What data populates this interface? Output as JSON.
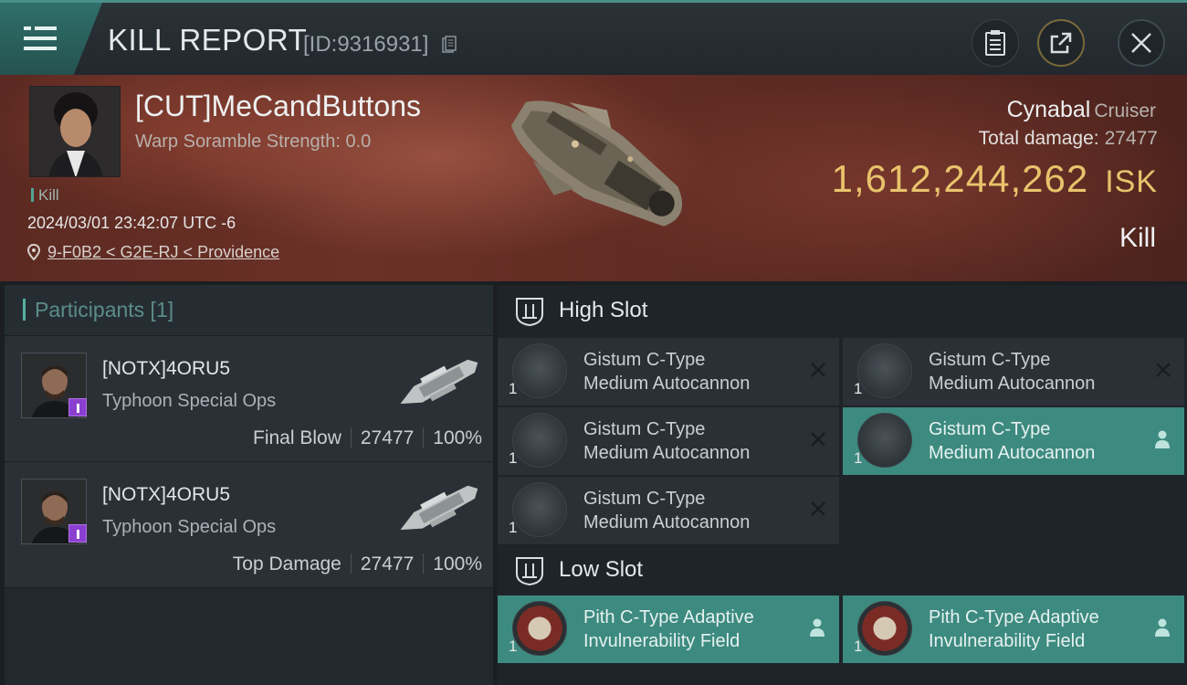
{
  "header": {
    "title": "KILL REPORT",
    "id_text": "[ID:9316931]"
  },
  "victim": {
    "name": "[CUT]MeCandButtons",
    "scramble": "Warp Soramble Strength: 0.0",
    "type_tag": "Kill",
    "datetime": "2024/03/01 23:42:07 UTC -6",
    "location": "9-F0B2 < G2E-RJ < Providence",
    "ship_name": "Cynabal",
    "ship_class": "Cruiser",
    "total_damage_label": "Total damage:",
    "total_damage": "27477",
    "isk_value": "1,612,244,262",
    "isk_unit": "ISK",
    "result": "Kill"
  },
  "participants": {
    "title": "Participants [1]",
    "rows": [
      {
        "name": "[NOTX]4ORU5",
        "ship": "Typhoon Special Ops",
        "role": "Final Blow",
        "damage": "27477",
        "pct": "100%"
      },
      {
        "name": "[NOTX]4ORU5",
        "ship": "Typhoon Special Ops",
        "role": "Top Damage",
        "damage": "27477",
        "pct": "100%"
      }
    ]
  },
  "fitting": {
    "high_slot_label": "High Slot",
    "low_slot_label": "Low Slot",
    "high": [
      {
        "line1": "Gistum C-Type",
        "line2": "Medium Autocannon",
        "qty": "1",
        "status": "destroyed"
      },
      {
        "line1": "Gistum C-Type",
        "line2": "Medium Autocannon",
        "qty": "1",
        "status": "destroyed"
      },
      {
        "line1": "Gistum C-Type",
        "line2": "Medium Autocannon",
        "qty": "1",
        "status": "destroyed"
      },
      {
        "line1": "Gistum C-Type",
        "line2": "Medium Autocannon",
        "qty": "1",
        "status": "dropped"
      },
      {
        "line1": "Gistum C-Type",
        "line2": "Medium Autocannon",
        "qty": "1",
        "status": "destroyed"
      }
    ],
    "low": [
      {
        "line1": "Pith C-Type Adaptive",
        "line2": "Invulnerability Field",
        "qty": "1",
        "status": "dropped"
      },
      {
        "line1": "Pith C-Type Adaptive",
        "line2": "Invulnerability Field",
        "qty": "1",
        "status": "dropped"
      }
    ]
  },
  "colors": {
    "accent_teal": "#3d8a80",
    "isk_gold": "#e8c36c",
    "banner_red": "#5c2a22"
  }
}
